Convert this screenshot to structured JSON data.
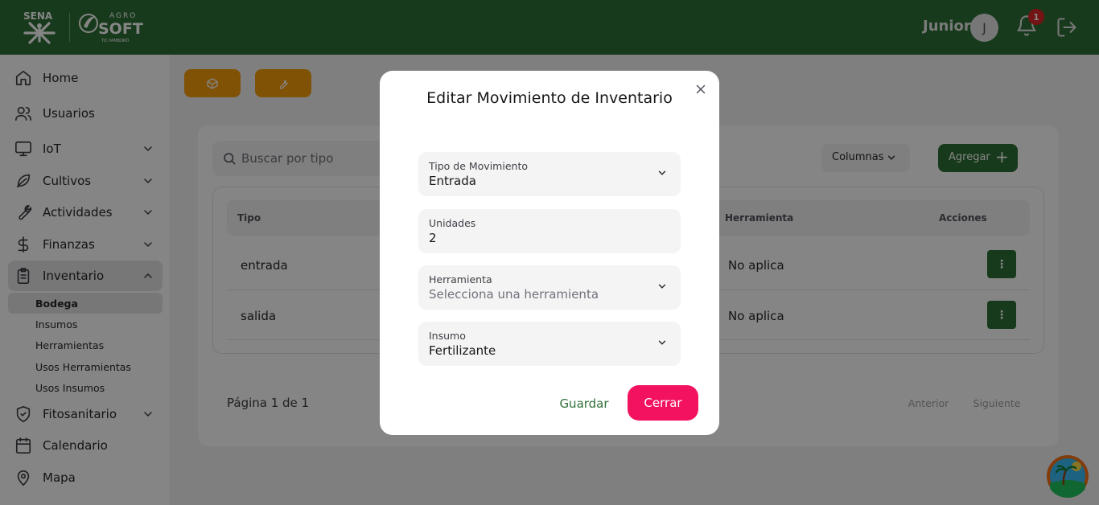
{
  "header": {
    "logo_sena": "SENA",
    "logo_agro_top": "AGRO",
    "logo_agro_main": "SOFT",
    "logo_agro_sub": "TIC-YAMBORÓ",
    "user_name": "Junior",
    "avatar_initial": "J",
    "notification_count": "1",
    "bell_icon": "bell-icon",
    "logout_icon": "logout-icon"
  },
  "sidebar": {
    "items": [
      {
        "label": "Home",
        "icon": "home-icon"
      },
      {
        "label": "Usuarios",
        "icon": "users-icon"
      },
      {
        "label": "IoT",
        "icon": "monitor-icon"
      },
      {
        "label": "Cultivos",
        "icon": "leaf-icon"
      },
      {
        "label": "Actividades",
        "icon": "wrench-icon"
      },
      {
        "label": "Finanzas",
        "icon": "dollar-icon"
      },
      {
        "label": "Inventario",
        "icon": "clipboard-icon"
      },
      {
        "label": "Fitosanitario",
        "icon": "shield-icon"
      },
      {
        "label": "Calendario",
        "icon": "calendar-icon"
      },
      {
        "label": "Mapa",
        "icon": "map-pin-icon"
      }
    ],
    "sub_items": [
      "Bodega",
      "Insumos",
      "Herramientas",
      "Usos Herramientas",
      "Usos Insumos"
    ],
    "active_sub": "Bodega"
  },
  "main": {
    "search_placeholder": "Buscar por tipo",
    "columns_label": "Columnas",
    "add_label": "Agregar",
    "table": {
      "headers": {
        "tipo": "Tipo",
        "herramienta": "Herramienta",
        "acciones": "Acciones"
      },
      "rows": [
        {
          "tipo": "entrada",
          "herramienta": "No aplica"
        },
        {
          "tipo": "salida",
          "herramienta": "No aplica"
        }
      ],
      "action_glyph": "⋮"
    },
    "pager": {
      "text": "Página 1 de 1",
      "prev": "Anterior",
      "next": "Siguiente"
    }
  },
  "modal": {
    "title": "Editar Movimiento de Inventario",
    "fields": [
      {
        "label": "Tipo de Movimiento",
        "value": "Entrada",
        "placeholder": false
      },
      {
        "label": "Unidades",
        "value": "2",
        "placeholder": false
      },
      {
        "label": "Herramienta",
        "value": "Selecciona una herramienta",
        "placeholder": true
      },
      {
        "label": "Insumo",
        "value": "Fertilizante",
        "placeholder": false
      }
    ],
    "save_label": "Guardar",
    "close_label": "Cerrar"
  },
  "colors": {
    "brand_green": "#2e7036",
    "accent_orange": "#f59e0b",
    "danger_pink": "#f31260"
  }
}
